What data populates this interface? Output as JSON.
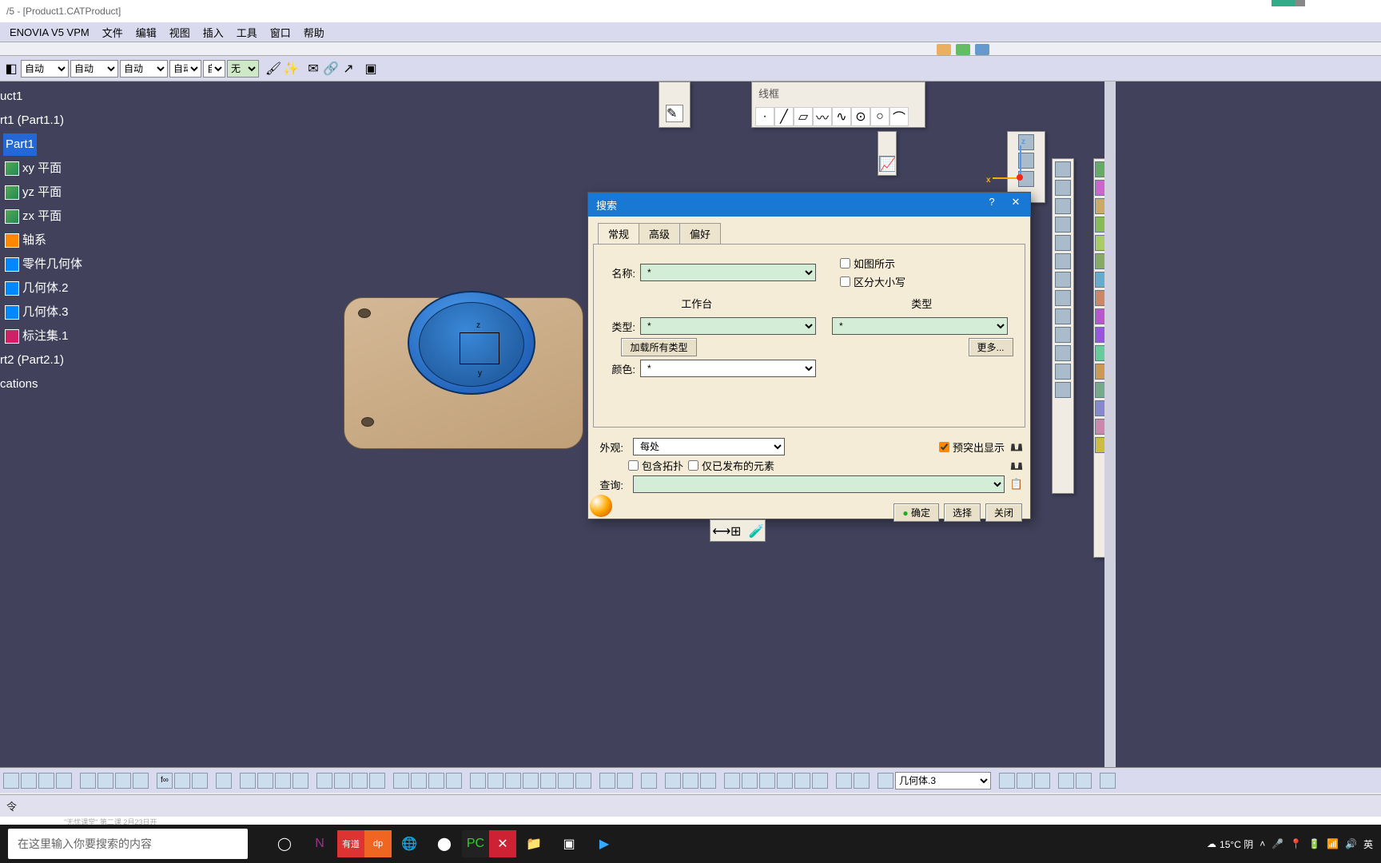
{
  "title": "/5 - [Product1.CATProduct]",
  "menu": [
    "ENOVIA V5 VPM",
    "文件",
    "编辑",
    "视图",
    "插入",
    "工具",
    "窗口",
    "帮助"
  ],
  "toolbar_selects": {
    "s1": "自动",
    "s2": "自动",
    "s3": "自动",
    "s4": "自动",
    "s5": "自动",
    "s6": "无"
  },
  "tree": {
    "root": "uct1",
    "n1": "rt1 (Part1.1)",
    "n2": "Part1",
    "n3": "xy 平面",
    "n4": "yz 平面",
    "n5": "zx 平面",
    "n6": "轴系",
    "n7": "零件几何体",
    "n8": "几何体.2",
    "n9": "几何体.3",
    "n10": "标注集.1",
    "n11": "rt2 (Part2.1)",
    "n12": "cations"
  },
  "float_wireframe": "线框",
  "coord": {
    "x": "x",
    "z": "z"
  },
  "part_axes": {
    "z": "z",
    "y": "y"
  },
  "dialog": {
    "title": "搜索",
    "help": "?",
    "close": "✕",
    "tabs": {
      "general": "常规",
      "advanced": "高级",
      "pref": "偏好"
    },
    "name_lbl": "名称:",
    "name_val": "*",
    "as_shown": "如图所示",
    "case": "区分大小写",
    "type_lbl": "类型:",
    "type_val": "*",
    "workbench": "工作台",
    "type_col2": "类型",
    "load_btn": "加载所有类型",
    "color_lbl": "颜色:",
    "color_val": "*",
    "more_btn": "更多...",
    "look_lbl": "外观:",
    "look_val": "每处",
    "pre_hl": "预突出显示",
    "topo": "包含拓扑",
    "pub": "仅已发布的元素",
    "query_lbl": "查询:",
    "ok": "确定",
    "sel": "选择",
    "close_btn": "关闭"
  },
  "bottom_select": "几何体.3",
  "status": "令",
  "search_placeholder": "在这里输入你要搜索的内容",
  "weather": "15°C 阴",
  "ime": "英",
  "bottom_hint": "\"无忧课堂\" 第二课 2月23日开"
}
